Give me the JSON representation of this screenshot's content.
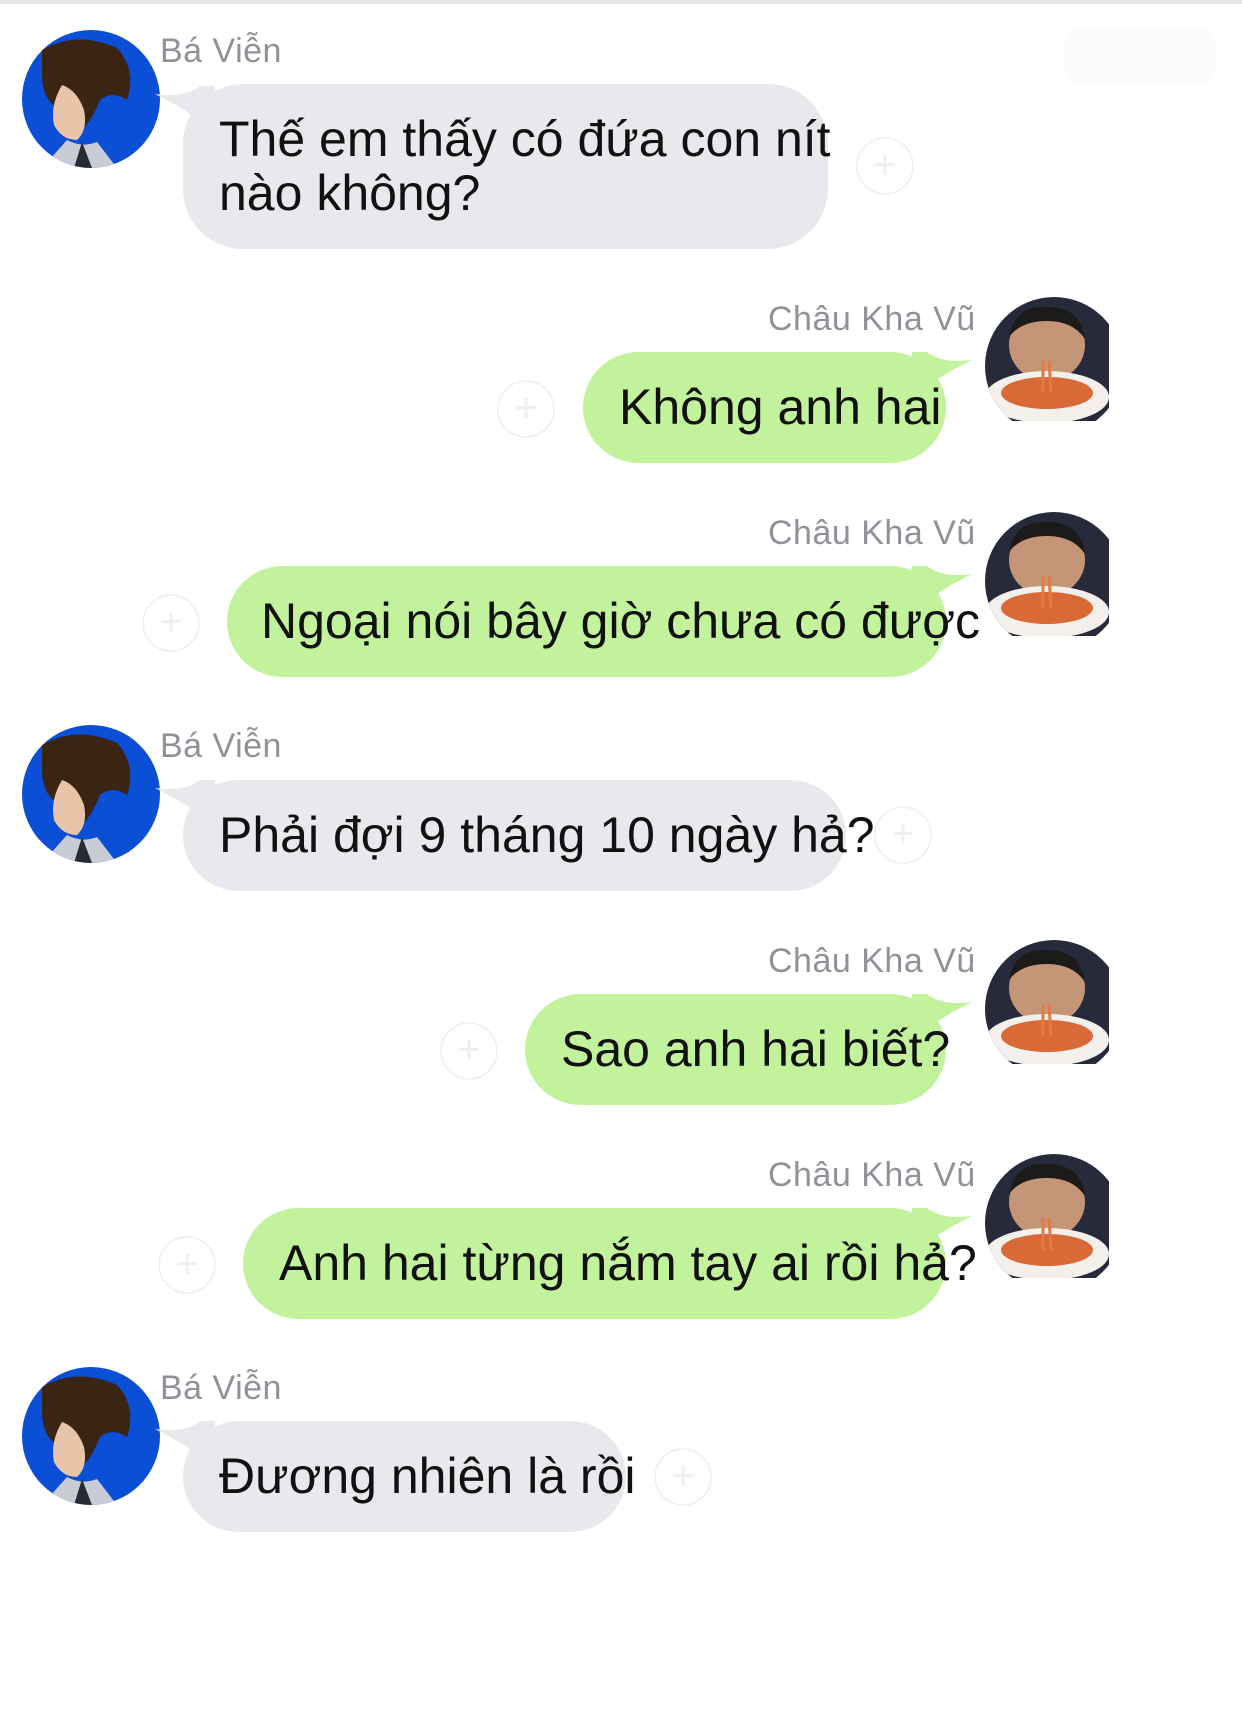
{
  "colors": {
    "incoming_bubble": "#e7e9ec",
    "outgoing_bubble": "#c2f29b",
    "sender_name": "#8f9399",
    "message_text": "#111111",
    "avatar_ba_vien_bg": "#0a4fd6"
  },
  "icons": {
    "reaction": "plus-circle-icon",
    "avatar_ba_vien": "profile-photo",
    "avatar_chau_kha_vu": "profile-photo"
  },
  "reaction_glyph": "+",
  "messages": [
    {
      "sender": "Bá Viễn",
      "direction": "in",
      "lines": [
        "Thế em thấy có đứa con nít",
        "nào không?"
      ]
    },
    {
      "sender": "Châu Kha Vũ",
      "direction": "out",
      "lines": [
        "Không anh hai"
      ]
    },
    {
      "sender": "Châu Kha Vũ",
      "direction": "out",
      "lines": [
        "Ngoại nói bây giờ chưa có được"
      ]
    },
    {
      "sender": "Bá Viễn",
      "direction": "in",
      "lines": [
        "Phải đợi 9 tháng 10 ngày hả?"
      ]
    },
    {
      "sender": "Châu Kha Vũ",
      "direction": "out",
      "lines": [
        "Sao anh hai biết?"
      ]
    },
    {
      "sender": "Châu Kha Vũ",
      "direction": "out",
      "lines": [
        "Anh hai từng nắm tay ai rồi hả?"
      ]
    },
    {
      "sender": "Bá Viễn",
      "direction": "in",
      "lines": [
        "Đương nhiên là rồi"
      ]
    }
  ]
}
